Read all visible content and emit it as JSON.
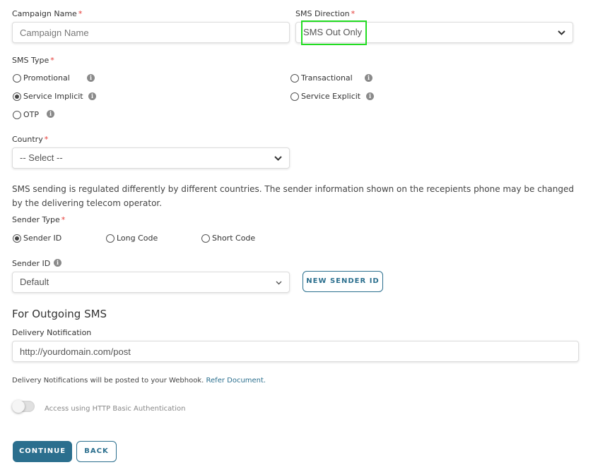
{
  "campaign_name": {
    "label": "Campaign Name",
    "required": "*",
    "placeholder": "Campaign Name",
    "value": ""
  },
  "sms_direction": {
    "label": "SMS Direction",
    "required": "*",
    "selected": "SMS Out Only"
  },
  "sms_type": {
    "label": "SMS Type",
    "required": "*",
    "options": [
      {
        "label": "Promotional",
        "checked": false
      },
      {
        "label": "Transactional",
        "checked": false
      },
      {
        "label": "Service Implicit",
        "checked": true
      },
      {
        "label": "Service Explicit",
        "checked": false
      },
      {
        "label": "OTP",
        "checked": false
      }
    ]
  },
  "country": {
    "label": "Country",
    "required": "*",
    "selected": "-- Select --"
  },
  "regulation_note": "SMS sending is regulated differently by different countries. The sender information shown on the recepients phone may be changed by the delivering telecom operator.",
  "sender_type": {
    "label": "Sender Type",
    "required": "*",
    "options": [
      {
        "label": "Sender ID",
        "checked": true
      },
      {
        "label": "Long Code",
        "checked": false
      },
      {
        "label": "Short Code",
        "checked": false
      }
    ]
  },
  "sender_id": {
    "label": "Sender ID",
    "selected": "Default",
    "new_button": "NEW SENDER ID"
  },
  "outgoing": {
    "heading": "For Outgoing SMS",
    "delivery_label": "Delivery Notification",
    "delivery_value": "http://yourdomain.com/post",
    "note_text": "Delivery Notifications will be posted to your Webhook.",
    "note_link": "Refer Document.",
    "auth_label": "Access using HTTP Basic Authentication",
    "auth_enabled": false
  },
  "actions": {
    "continue": "CONTINUE",
    "back": "BACK"
  },
  "colors": {
    "accent": "#2b6f8e",
    "required": "#e53935",
    "highlight": "#22dd22",
    "link": "#2b6f8e"
  },
  "icons": {
    "info": "info-icon",
    "chevron": "chevron-down-icon"
  }
}
